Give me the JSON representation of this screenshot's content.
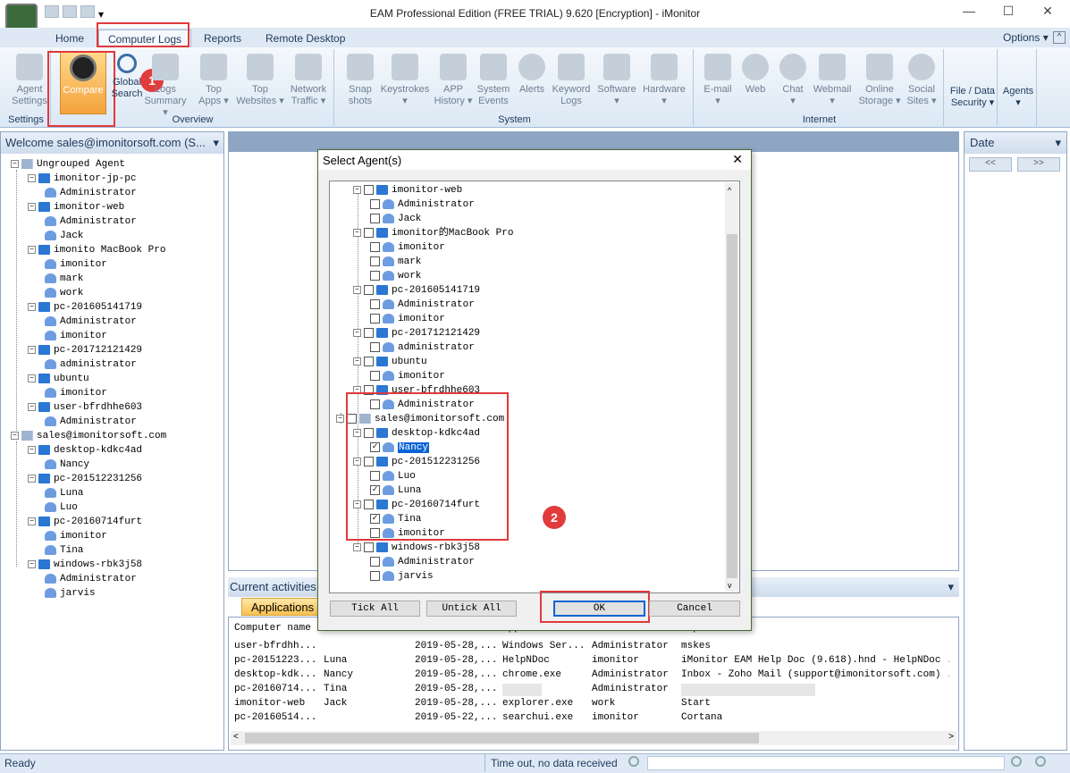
{
  "window": {
    "title": "EAM Professional Edition (FREE TRIAL) 9.620 [Encryption] - iMonitor",
    "minimize": "—",
    "maximize": "☐",
    "close": "✕"
  },
  "tabs": [
    "Home",
    "Computer Logs",
    "Reports",
    "Remote Desktop"
  ],
  "options_label": "Options ▾",
  "ribbon": {
    "groups": {
      "settings": "Settings",
      "overview": "Overview",
      "system": "System",
      "internet": "Internet"
    },
    "buttons": {
      "agent_settings": [
        "Agent",
        "Settings"
      ],
      "compare": [
        "Compare",
        ""
      ],
      "global_search": [
        "Global",
        "Search"
      ],
      "logs_summary": [
        "Logs",
        "Summary ▾"
      ],
      "top_apps": [
        "Top",
        "Apps ▾"
      ],
      "top_websites": [
        "Top",
        "Websites ▾"
      ],
      "network_traffic": [
        "Network",
        "Traffic ▾"
      ],
      "snapshots": [
        "Snap",
        "shots"
      ],
      "keystrokes": [
        "Keystrokes",
        "▾"
      ],
      "app_history": [
        "APP",
        "History ▾"
      ],
      "system_events": [
        "System",
        "Events"
      ],
      "alerts": [
        "Alerts",
        ""
      ],
      "keyword_logs": [
        "Keyword",
        "Logs"
      ],
      "software": [
        "Software",
        "▾"
      ],
      "hardware": [
        "Hardware",
        "▾"
      ],
      "email": [
        "E-mail",
        "▾"
      ],
      "web": [
        "Web",
        ""
      ],
      "chat": [
        "Chat",
        "▾"
      ],
      "webmail": [
        "Webmail",
        "▾"
      ],
      "online_storage": [
        "Online",
        "Storage ▾"
      ],
      "social_sites": [
        "Social",
        "Sites ▾"
      ],
      "file_data_security": [
        "File / Data",
        "Security ▾"
      ],
      "agents": [
        "Agents",
        "▾"
      ]
    }
  },
  "badges": {
    "one": "1",
    "two": "2"
  },
  "left_pane": {
    "header": "Welcome sales@imonitorsoft.com (S...",
    "tree": [
      {
        "label": "Ungrouped Agent",
        "type": "group",
        "level": 0
      },
      {
        "label": "imonitor-jp-pc",
        "type": "comp",
        "level": 1
      },
      {
        "label": "Administrator",
        "type": "user",
        "level": 2
      },
      {
        "label": "imonitor-web",
        "type": "comp",
        "level": 1
      },
      {
        "label": "Administrator",
        "type": "user",
        "level": 2
      },
      {
        "label": "Jack",
        "type": "user",
        "level": 2
      },
      {
        "label": "imonito   MacBook Pro",
        "type": "comp",
        "level": 1
      },
      {
        "label": "imonitor",
        "type": "user",
        "level": 2
      },
      {
        "label": "mark",
        "type": "user",
        "level": 2
      },
      {
        "label": "work",
        "type": "user",
        "level": 2
      },
      {
        "label": "pc-201605141719",
        "type": "comp",
        "level": 1
      },
      {
        "label": "Administrator",
        "type": "user",
        "level": 2
      },
      {
        "label": "imonitor",
        "type": "user",
        "level": 2
      },
      {
        "label": "pc-201712121429",
        "type": "comp",
        "level": 1
      },
      {
        "label": "administrator",
        "type": "user",
        "level": 2
      },
      {
        "label": "ubuntu",
        "type": "comp",
        "level": 1
      },
      {
        "label": "imonitor",
        "type": "user",
        "level": 2
      },
      {
        "label": "user-bfrdhhe603",
        "type": "comp",
        "level": 1
      },
      {
        "label": "Administrator",
        "type": "user",
        "level": 2
      },
      {
        "label": "sales@imonitorsoft.com",
        "type": "group",
        "level": 0
      },
      {
        "label": "desktop-kdkc4ad",
        "type": "comp",
        "level": 1
      },
      {
        "label": "Nancy",
        "type": "user",
        "level": 2
      },
      {
        "label": "pc-201512231256",
        "type": "comp",
        "level": 1
      },
      {
        "label": "Luna",
        "type": "user",
        "level": 2
      },
      {
        "label": "Luo",
        "type": "user",
        "level": 2
      },
      {
        "label": "pc-20160714furt",
        "type": "comp",
        "level": 1
      },
      {
        "label": "imonitor",
        "type": "user",
        "level": 2
      },
      {
        "label": "Tina",
        "type": "user",
        "level": 2
      },
      {
        "label": "windows-rbk3j58",
        "type": "comp",
        "level": 1
      },
      {
        "label": "Administrator",
        "type": "user",
        "level": 2
      },
      {
        "label": "jarvis",
        "type": "user",
        "level": 2
      }
    ]
  },
  "dialog": {
    "title": "Select Agent(s)",
    "close": "✕",
    "tree": [
      {
        "label": "imonitor-web",
        "type": "comp",
        "level": 1,
        "checked": false
      },
      {
        "label": "Administrator",
        "type": "user",
        "level": 2,
        "checked": false
      },
      {
        "label": "Jack",
        "type": "user",
        "level": 2,
        "checked": false
      },
      {
        "label": "imonitor的MacBook Pro",
        "type": "comp",
        "level": 1,
        "checked": false
      },
      {
        "label": "imonitor",
        "type": "user",
        "level": 2,
        "checked": false
      },
      {
        "label": "mark",
        "type": "user",
        "level": 2,
        "checked": false
      },
      {
        "label": "work",
        "type": "user",
        "level": 2,
        "checked": false
      },
      {
        "label": "pc-201605141719",
        "type": "comp",
        "level": 1,
        "checked": false
      },
      {
        "label": "Administrator",
        "type": "user",
        "level": 2,
        "checked": false
      },
      {
        "label": "imonitor",
        "type": "user",
        "level": 2,
        "checked": false
      },
      {
        "label": "pc-201712121429",
        "type": "comp",
        "level": 1,
        "checked": false
      },
      {
        "label": "administrator",
        "type": "user",
        "level": 2,
        "checked": false
      },
      {
        "label": "ubuntu",
        "type": "comp",
        "level": 1,
        "checked": false
      },
      {
        "label": "imonitor",
        "type": "user",
        "level": 2,
        "checked": false
      },
      {
        "label": "user-bfrdhhe603",
        "type": "comp",
        "level": 1,
        "checked": false
      },
      {
        "label": "Administrator",
        "type": "user",
        "level": 2,
        "checked": false
      },
      {
        "label": "sales@imonitorsoft.com",
        "type": "group",
        "level": 0,
        "checked": false
      },
      {
        "label": "desktop-kdkc4ad",
        "type": "comp",
        "level": 1,
        "checked": false
      },
      {
        "label": "Nancy",
        "type": "user",
        "level": 2,
        "checked": true,
        "selected": true
      },
      {
        "label": "pc-201512231256",
        "type": "comp",
        "level": 1,
        "checked": false
      },
      {
        "label": "Luo",
        "type": "user",
        "level": 2,
        "checked": false
      },
      {
        "label": "Luna",
        "type": "user",
        "level": 2,
        "checked": true
      },
      {
        "label": "pc-20160714furt",
        "type": "comp",
        "level": 1,
        "checked": false
      },
      {
        "label": "Tina",
        "type": "user",
        "level": 2,
        "checked": true
      },
      {
        "label": "imonitor",
        "type": "user",
        "level": 2,
        "checked": false
      },
      {
        "label": "windows-rbk3j58",
        "type": "comp",
        "level": 1,
        "checked": false
      },
      {
        "label": "Administrator",
        "type": "user",
        "level": 2,
        "checked": false
      },
      {
        "label": "jarvis",
        "type": "user",
        "level": 2,
        "checked": false
      }
    ],
    "buttons": {
      "tick_all": "Tick All",
      "untick_all": "Untick All",
      "ok": "OK",
      "cancel": "Cancel"
    }
  },
  "current_activities": {
    "header": "Current activities",
    "tab": "Applications",
    "columns": [
      "Computer name",
      "Contact Name",
      "Time",
      "Application...",
      "User",
      "Caption"
    ],
    "rows": [
      [
        "user-bfrdhh...",
        "",
        "2019-05-28,...",
        "Windows Ser...",
        "Administrator",
        "mskes"
      ],
      [
        "pc-20151223...",
        "Luna",
        "2019-05-28,...",
        "HelpNDoc",
        "imonitor",
        "iMonitor EAM Help Doc (9.618).hnd - HelpNDoc ..."
      ],
      [
        "desktop-kdk...",
        "Nancy",
        "2019-05-28,...",
        "chrome.exe",
        "Administrator",
        "Inbox - Zoho Mail (support@imonitorsoft.com) ..."
      ],
      [
        "pc-20160714...",
        "Tina",
        "2019-05-28,...",
        "",
        "Administrator",
        ""
      ],
      [
        "imonitor-web",
        "Jack",
        "2019-05-28,...",
        "explorer.exe",
        "work",
        "Start"
      ],
      [
        "pc-20160514...",
        "",
        "2019-05-22,...",
        "searchui.exe",
        "imonitor",
        "Cortana"
      ]
    ]
  },
  "right_pane": {
    "header": "Date",
    "prev": "<<",
    "next": ">>"
  },
  "status": {
    "left": "Ready",
    "message": "Time out, no data received"
  }
}
